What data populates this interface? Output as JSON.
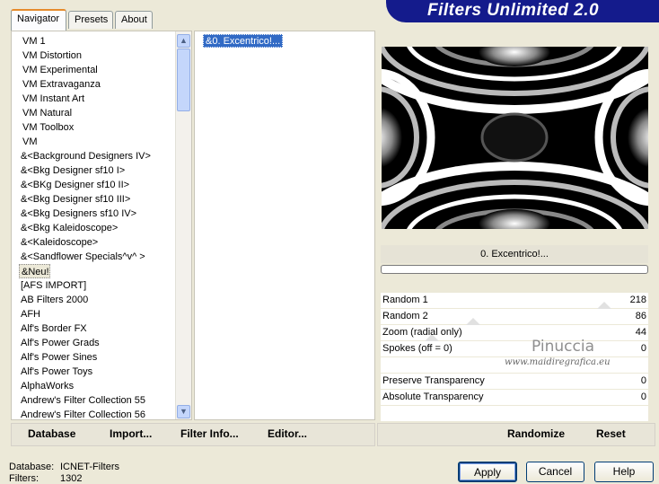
{
  "tabs": [
    "Navigator",
    "Presets",
    "About"
  ],
  "title": "Filters Unlimited 2.0",
  "categories": [
    "VM 1",
    "VM Distortion",
    "VM Experimental",
    "VM Extravaganza",
    "VM Instant Art",
    "VM Natural",
    "VM Toolbox",
    "VM",
    "&<Background Designers IV>",
    "&<Bkg Designer sf10 I>",
    "&<BKg Designer sf10 II>",
    "&<Bkg Designer sf10 III>",
    "&<Bkg Designers sf10 IV>",
    "&<Bkg Kaleidoscope>",
    "&<Kaleidoscope>",
    "&<Sandflower Specials^v^ >",
    "&Neu!",
    "[AFS IMPORT]",
    "AB Filters 2000",
    "AFH",
    "Alf's Border FX",
    "Alf's Power Grads",
    "Alf's Power Sines",
    "Alf's Power Toys",
    "AlphaWorks",
    "Andrew's Filter Collection 55",
    "Andrew's Filter Collection 56"
  ],
  "selected_category_index": 16,
  "filters": [
    "&0. Excentrico!..."
  ],
  "filter_name": "0. Excentrico!...",
  "progress": 0,
  "params": [
    {
      "label": "Random 1",
      "value": "218",
      "level": 0.855
    },
    {
      "label": "Random 2",
      "value": "86",
      "level": 0.337
    },
    {
      "label": "Zoom (radial only)",
      "value": "44",
      "level": 0.173
    },
    {
      "label": "Spokes (off = 0)",
      "value": "0",
      "level": 0
    },
    {
      "label": "",
      "value": "",
      "level": null
    },
    {
      "label": "Preserve Transparency",
      "value": "0",
      "level": 0
    },
    {
      "label": "Absolute  Transparency",
      "value": "0",
      "level": 0
    },
    {
      "label": "",
      "value": "",
      "level": null
    }
  ],
  "watermark": {
    "name": "Pinuccia",
    "site": "www.maidiregrafica.eu"
  },
  "toolbar": {
    "database": "Database",
    "import": "Import...",
    "filter_info": "Filter Info...",
    "editor": "Editor...",
    "randomize": "Randomize",
    "reset": "Reset"
  },
  "status": {
    "database_label": "Database:",
    "database_value": "ICNET-Filters",
    "filters_label": "Filters:",
    "filters_value": "1302"
  },
  "buttons": {
    "apply": "Apply",
    "cancel": "Cancel",
    "help": "Help"
  }
}
